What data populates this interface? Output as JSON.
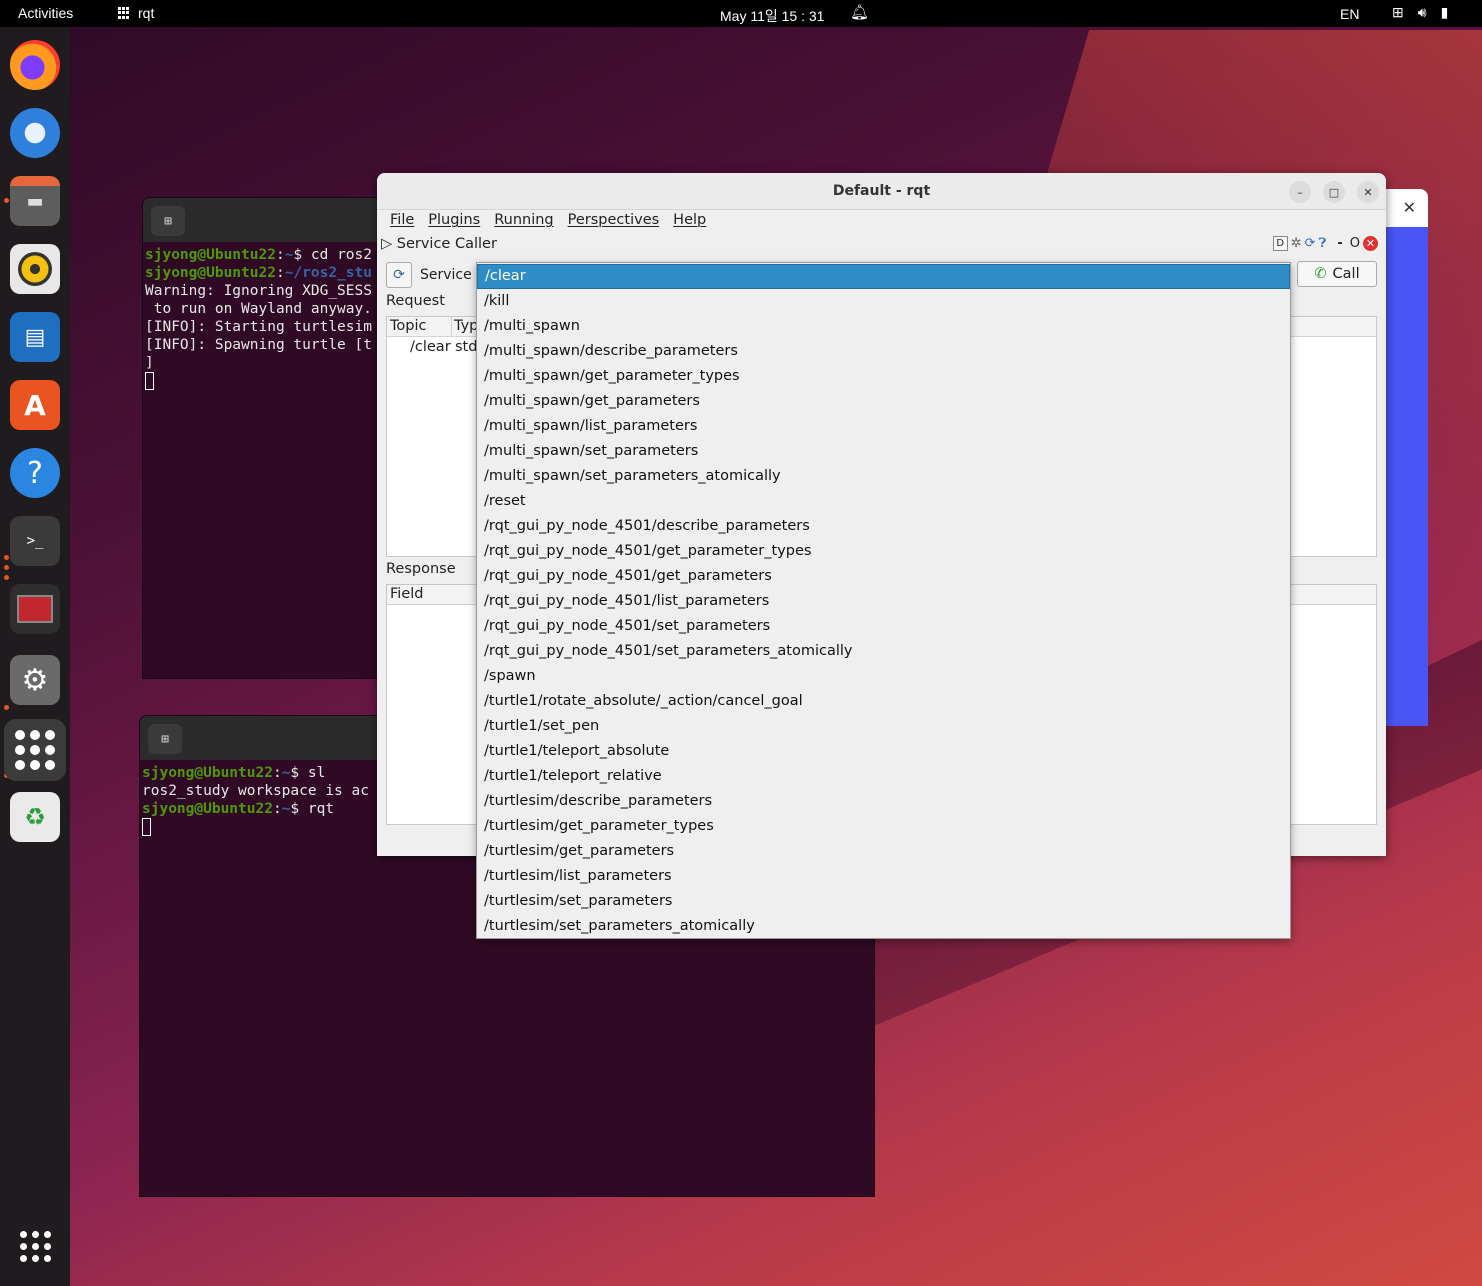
{
  "topbar": {
    "activities": "Activities",
    "app_name": "rqt",
    "clock": "May 11일  15 : 31",
    "language": "EN"
  },
  "dock": {
    "items": [
      "firefox",
      "thunderbird",
      "files",
      "rhythmbox",
      "libreoffice-writer",
      "app-center",
      "help",
      "terminal",
      "terminator",
      "settings",
      "show-apps-running",
      "trash"
    ]
  },
  "terminal1": {
    "lines": [
      {
        "user": "sjyong@Ubuntu22",
        "path": "~",
        "cmd": "$ cd ros2"
      },
      {
        "user": "sjyong@Ubuntu22",
        "path": "~/ros2_stu",
        "cmd": ""
      }
    ],
    "output": [
      "Warning: Ignoring XDG_SESS",
      " to run on Wayland anyway.",
      "[INFO]: Starting turtlesim",
      "[INFO]: Spawning turtle [t",
      "]"
    ]
  },
  "terminal2": {
    "line1": {
      "user": "sjyong@Ubuntu22",
      "path": "~",
      "cmd": "$ sl"
    },
    "output": "ros2_study workspace is ac",
    "line2": {
      "user": "sjyong@Ubuntu22",
      "path": "~",
      "cmd": "$ rqt"
    }
  },
  "rqt": {
    "title": "Default - rqt",
    "menu": [
      "File",
      "Plugins",
      "Running",
      "Perspectives",
      "Help"
    ],
    "plugin_title": "Service Caller",
    "plugin_tools": {
      "d": "D",
      "dash": "-",
      "o": "O"
    },
    "service_label": "Service",
    "call_label": "Call",
    "request_label": "Request",
    "request_headers": {
      "topic": "Topic",
      "type": "Typ"
    },
    "request_row": {
      "topic": "/clear",
      "type": "std"
    },
    "response_label": "Response",
    "response_headers": {
      "field": "Field"
    }
  },
  "dropdown": {
    "selected_index": 0,
    "options": [
      "/clear",
      "/kill",
      "/multi_spawn",
      "/multi_spawn/describe_parameters",
      "/multi_spawn/get_parameter_types",
      "/multi_spawn/get_parameters",
      "/multi_spawn/list_parameters",
      "/multi_spawn/set_parameters",
      "/multi_spawn/set_parameters_atomically",
      "/reset",
      "/rqt_gui_py_node_4501/describe_parameters",
      "/rqt_gui_py_node_4501/get_parameter_types",
      "/rqt_gui_py_node_4501/get_parameters",
      "/rqt_gui_py_node_4501/list_parameters",
      "/rqt_gui_py_node_4501/set_parameters",
      "/rqt_gui_py_node_4501/set_parameters_atomically",
      "/spawn",
      "/turtle1/rotate_absolute/_action/cancel_goal",
      "/turtle1/set_pen",
      "/turtle1/teleport_absolute",
      "/turtle1/teleport_relative",
      "/turtlesim/describe_parameters",
      "/turtlesim/get_parameter_types",
      "/turtlesim/get_parameters",
      "/turtlesim/list_parameters",
      "/turtlesim/set_parameters",
      "/turtlesim/set_parameters_atomically"
    ]
  },
  "colors": {
    "accent": "#308cc6",
    "terminal_bg": "#300a24",
    "prompt_user": "#4e9a06",
    "prompt_path": "#3465a4"
  }
}
